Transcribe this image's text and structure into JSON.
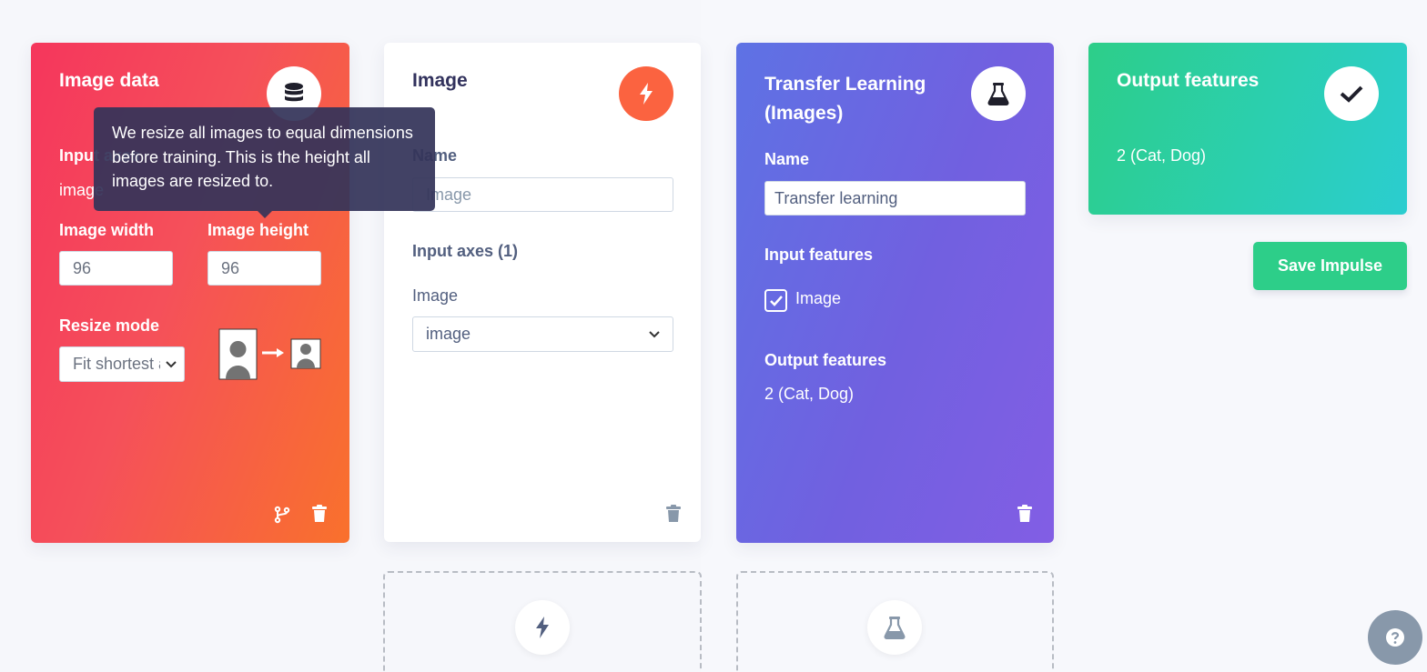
{
  "image_data_block": {
    "title": "Image data",
    "input_axes_label": "Input axes",
    "input_axes_value": "image",
    "width_label": "Image width",
    "width_value": "96",
    "height_label": "Image height",
    "height_value": "96",
    "resize_mode_label": "Resize mode",
    "resize_mode_value": "Fit shortest axis",
    "tooltip": "We resize all images to equal dimensions before training. This is the height all images are resized to."
  },
  "processing_block": {
    "title": "Image",
    "name_label": "Name",
    "name_value": "Image",
    "input_axes_label": "Input axes (1)",
    "image_label": "Image",
    "image_select_value": "image"
  },
  "learning_block": {
    "title_line1": "Transfer Learning",
    "title_line2": "(Images)",
    "name_label": "Name",
    "name_value": "Transfer learning",
    "input_features_label": "Input features",
    "input_feature_checkbox_label": "Image",
    "output_features_label": "Output features",
    "output_features_value": "2 (Cat, Dog)"
  },
  "output_block": {
    "title": "Output features",
    "value": "2 (Cat, Dog)"
  },
  "save_button_label": "Save Impulse",
  "icons": {
    "image_data": "database-icon",
    "processing": "bolt-icon",
    "learning": "flask-icon",
    "output": "checkmark-icon",
    "help": "question-icon"
  },
  "colors": {
    "image_data_card": "#f5365c",
    "processing_icon": "#fb6340",
    "learning_card": "#5e72e4",
    "output_card": "#2dce89",
    "save_button": "#2dce89"
  }
}
